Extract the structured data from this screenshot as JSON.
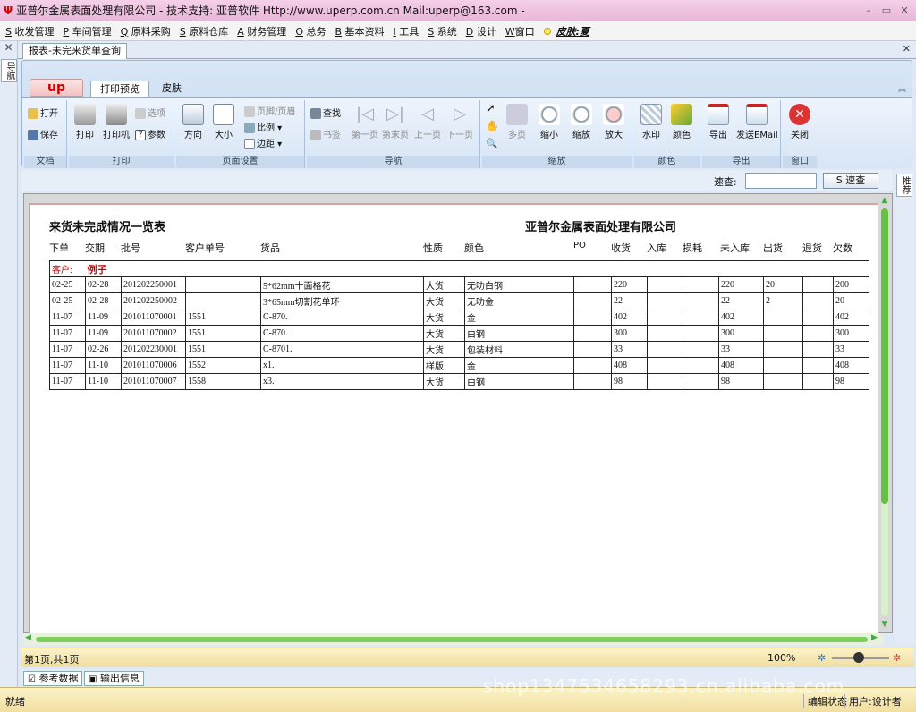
{
  "window": {
    "title": "亚普尔金属表面处理有限公司    - 技术支持: 亚普软件 Http://www.uperp.com.cn  Mail:uperp@163.com -"
  },
  "menu": [
    {
      "key": "S",
      "label": "收发管理"
    },
    {
      "key": "P",
      "label": "车间管理"
    },
    {
      "key": "Q",
      "label": "原料采购"
    },
    {
      "key": "S",
      "label": "原料仓库"
    },
    {
      "key": "A",
      "label": "财务管理"
    },
    {
      "key": "O",
      "label": "总务"
    },
    {
      "key": "B",
      "label": "基本资料"
    },
    {
      "key": "I",
      "label": "工具"
    },
    {
      "key": "S",
      "label": "系统"
    },
    {
      "key": "D",
      "label": "设计"
    },
    {
      "key": "W",
      "label": "窗口"
    }
  ],
  "menu_skin": "皮肤:夏",
  "left_strip": {
    "item1": "导航"
  },
  "doc_tab": "报表-未完来货单查询",
  "ribbon": {
    "app_tab": "up",
    "tabs": [
      "打印预览",
      "皮肤"
    ],
    "groups": {
      "file": {
        "label": "文档",
        "open": "打开",
        "save": "保存"
      },
      "print": {
        "label": "打印",
        "print": "打印",
        "printer": "打印机",
        "options": "选项",
        "params": "参数"
      },
      "page": {
        "label": "页面设置",
        "orientation": "方向",
        "size": "大小",
        "header_footer": "页脚/页眉",
        "scale": "比例",
        "margins": "边距"
      },
      "nav": {
        "label": "导航",
        "find": "查找",
        "bookmark": "书签",
        "first": "第一页",
        "last": "第末页",
        "prev": "上一页",
        "next": "下一页"
      },
      "zoom": {
        "label": "缩放",
        "multi": "多页",
        "zoom_out": "缩小",
        "zoom": "缩放",
        "zoom_in": "放大"
      },
      "color": {
        "label": "颜色",
        "watermark": "水印",
        "color": "颜色"
      },
      "export": {
        "label": "导出",
        "export": "导出",
        "email": "发送EMail"
      },
      "window": {
        "label": "窗口",
        "close": "关闭"
      }
    }
  },
  "quick_search": {
    "label": "速查:",
    "value": "",
    "button": "S 速查"
  },
  "right_strip": {
    "item1": "推荐"
  },
  "report": {
    "title": "来货未完成情况一览表",
    "company": "亚普尔金属表面处理有限公司",
    "columns": [
      "下单",
      "交期",
      "批号",
      "客户单号",
      "货品",
      "性质",
      "颜色",
      "PO",
      "收货",
      "入库",
      "损耗",
      "未入库",
      "出货",
      "退货",
      "欠数"
    ],
    "customer_label": "客户:",
    "customer_name": "例子",
    "rows": [
      [
        "02-25",
        "02-28",
        "201202250001",
        "",
        "5*62mm十面格花",
        "大货",
        "无叻白钢",
        "",
        "220",
        "",
        "",
        "220",
        "20",
        "",
        "200"
      ],
      [
        "02-25",
        "02-28",
        "201202250002",
        "",
        "3*65mm切割花单环",
        "大货",
        "无叻金",
        "",
        "22",
        "",
        "",
        "22",
        "2",
        "",
        "20"
      ],
      [
        "11-07",
        "11-09",
        "201011070001",
        "1551",
        "C-870.",
        "大货",
        "金",
        "",
        "402",
        "",
        "",
        "402",
        "",
        "",
        "402"
      ],
      [
        "11-07",
        "11-09",
        "201011070002",
        "1551",
        "C-870.",
        "大货",
        "白钢",
        "",
        "300",
        "",
        "",
        "300",
        "",
        "",
        "300"
      ],
      [
        "11-07",
        "02-26",
        "201202230001",
        "1551",
        "C-8701.",
        "大货",
        "包装材料",
        "",
        "33",
        "",
        "",
        "33",
        "",
        "",
        "33"
      ],
      [
        "11-07",
        "11-10",
        "201011070006",
        "1552",
        "x1.",
        "样版",
        "金",
        "",
        "408",
        "",
        "",
        "408",
        "",
        "",
        "408"
      ],
      [
        "11-07",
        "11-10",
        "201011070007",
        "1558",
        "x3.",
        "大货",
        "白钢",
        "",
        "98",
        "",
        "",
        "98",
        "",
        "",
        "98"
      ]
    ]
  },
  "page_status": {
    "pages": "第1页,共1页",
    "zoom": "100%"
  },
  "bottom_tabs": [
    "参考数据",
    "输出信息"
  ],
  "status": {
    "left": "就绪",
    "edit": "编辑状态",
    "user": "用户:设计者"
  },
  "watermark": "shop1347534658293.cn.alibaba.com",
  "colors": {
    "accent": "#c00000",
    "scroll": "#66c044",
    "titlebar": "#e7b6d9"
  }
}
